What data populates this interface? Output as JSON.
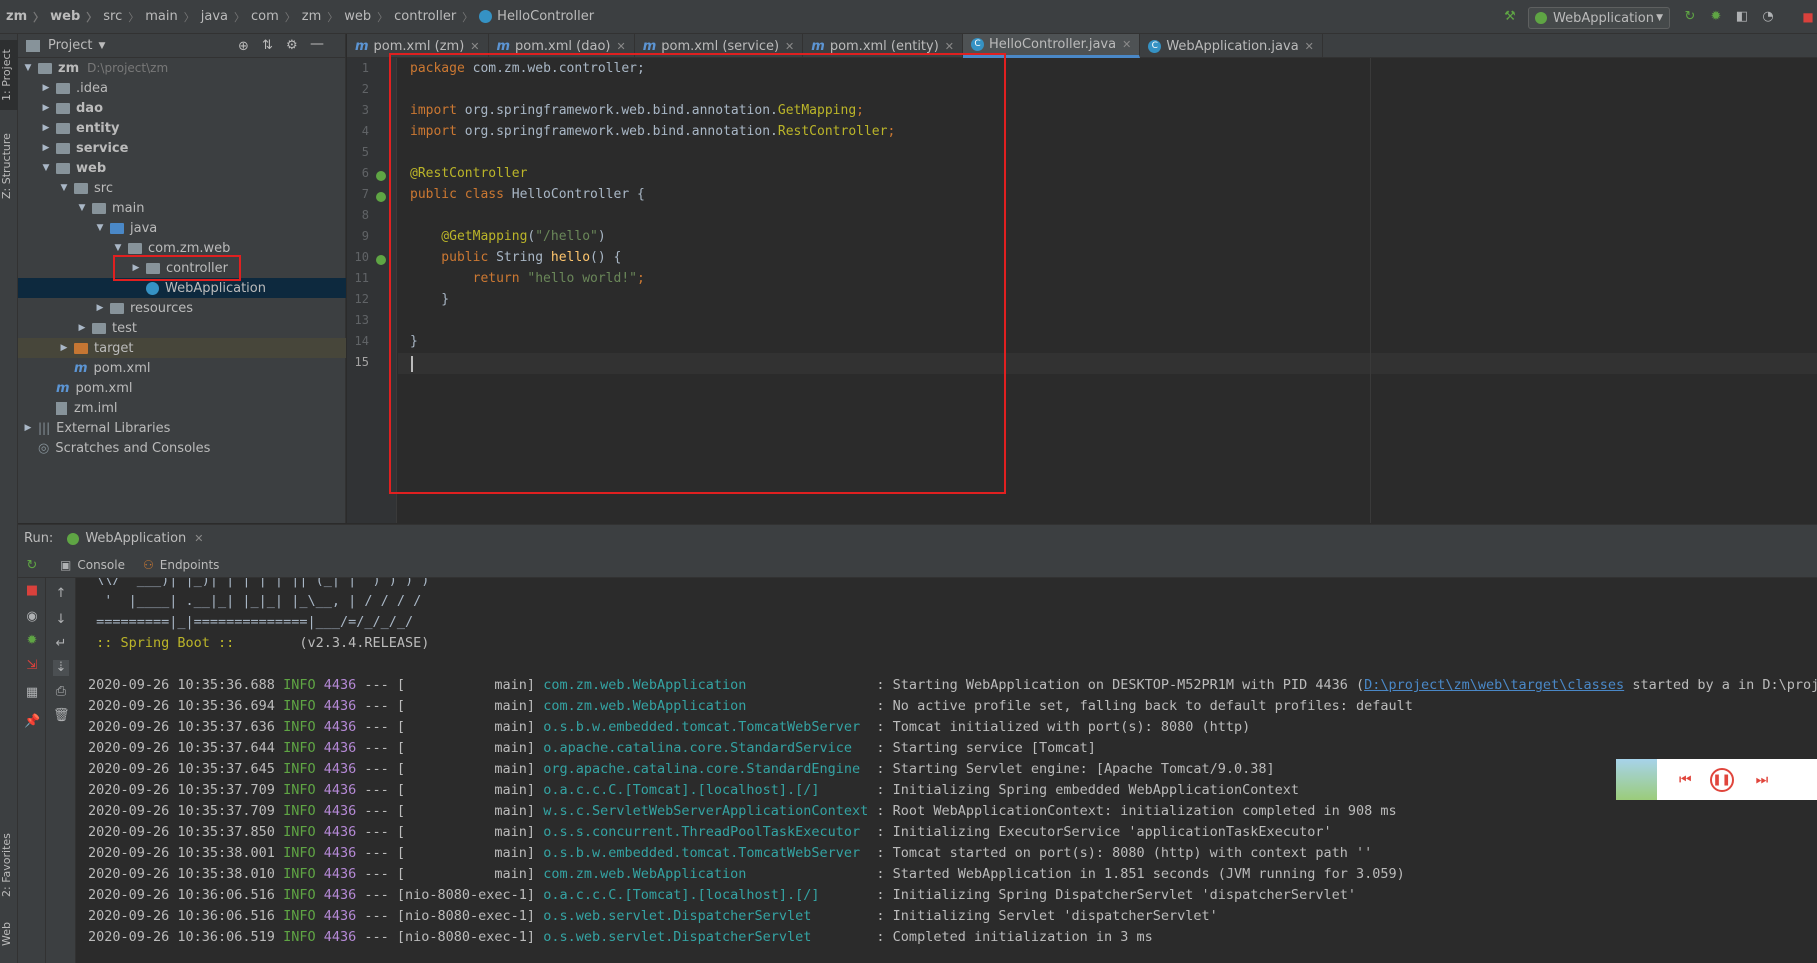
{
  "breadcrumb": [
    "zm",
    "web",
    "src",
    "main",
    "java",
    "com",
    "zm",
    "web",
    "controller",
    "HelloController"
  ],
  "run_config": "WebApplication",
  "left_stripe": {
    "project": "1: Project",
    "structure": "Z: Structure",
    "favorites": "2: Favorites",
    "web": "Web"
  },
  "project_panel": {
    "title": "Project",
    "tree": [
      {
        "label": "zm",
        "path": "D:\\project\\zm"
      },
      {
        "label": ".idea"
      },
      {
        "label": "dao"
      },
      {
        "label": "entity"
      },
      {
        "label": "service"
      },
      {
        "label": "web"
      },
      {
        "label": "src"
      },
      {
        "label": "main"
      },
      {
        "label": "java"
      },
      {
        "label": "com.zm.web"
      },
      {
        "label": "controller"
      },
      {
        "label": "WebApplication"
      },
      {
        "label": "resources"
      },
      {
        "label": "test"
      },
      {
        "label": "target"
      },
      {
        "label": "pom.xml"
      },
      {
        "label": "pom.xml"
      },
      {
        "label": "zm.iml"
      },
      {
        "label": "External Libraries"
      },
      {
        "label": "Scratches and Consoles"
      }
    ]
  },
  "editor_tabs": [
    {
      "label": "pom.xml (zm)"
    },
    {
      "label": "pom.xml (dao)"
    },
    {
      "label": "pom.xml (service)"
    },
    {
      "label": "pom.xml (entity)"
    },
    {
      "label": "HelloController.java",
      "active": true
    },
    {
      "label": "WebApplication.java"
    }
  ],
  "line_numbers": [
    "1",
    "2",
    "3",
    "4",
    "5",
    "6",
    "7",
    "8",
    "9",
    "10",
    "11",
    "12",
    "13",
    "14",
    "15"
  ],
  "code": {
    "l1_kw": "package",
    "l1_rest": " com.zm.web.controller;",
    "l3_kw": "import",
    "l3_rest": " org.springframework.web.bind.annotation.",
    "l3_ann": "GetMapping",
    "l3_end": ";",
    "l4_kw": "import",
    "l4_rest": " org.springframework.web.bind.annotation.",
    "l4_ann": "RestController",
    "l4_end": ";",
    "l6_ann": "@RestController",
    "l7_kw": "public class",
    "l7_rest": " HelloController {",
    "l9_ann": "    @GetMapping",
    "l9_p1": "(",
    "l9_str": "\"/hello\"",
    "l9_p2": ")",
    "l10_kw": "    public",
    "l10_type": " String ",
    "l10_fn": "hello",
    "l10_rest": "() {",
    "l11_kw": "        return",
    "l11_sp": " ",
    "l11_str": "\"hello world!\"",
    "l11_end": ";",
    "l12": "    }",
    "l14": "}"
  },
  "run": {
    "label": "Run:",
    "config": "WebApplication",
    "tabs": {
      "console": "Console",
      "endpoints": "Endpoints"
    }
  },
  "console": {
    "banner": [
      " \\\\/  ___)| |_)| | | | | || (_| |  ) ) ) )",
      "  '  |____| .__|_| |_|_| |_\\__, | / / / /",
      " =========|_|==============|___/=/_/_/_/"
    ],
    "spring_label": " :: Spring Boot ::",
    "spring_version": "        (v2.3.4.RELEASE)",
    "logs": [
      {
        "ts": "2020-09-26 10:35:36.688",
        "lvl": "INFO",
        "pid": "4436",
        "mid": " --- [           main] ",
        "logger": "com.zm.web.WebApplication               ",
        "msg": " : Starting WebApplication on DESKTOP-M52PR1M with PID 4436 (",
        "link": "D:\\project\\zm\\web\\target\\classes",
        "after": " started by a in D:\\project"
      },
      {
        "ts": "2020-09-26 10:35:36.694",
        "lvl": "INFO",
        "pid": "4436",
        "mid": " --- [           main] ",
        "logger": "com.zm.web.WebApplication               ",
        "msg": " : No active profile set, falling back to default profiles: default"
      },
      {
        "ts": "2020-09-26 10:35:37.636",
        "lvl": "INFO",
        "pid": "4436",
        "mid": " --- [           main] ",
        "logger": "o.s.b.w.embedded.tomcat.TomcatWebServer ",
        "msg": " : Tomcat initialized with port(s): 8080 (http)"
      },
      {
        "ts": "2020-09-26 10:35:37.644",
        "lvl": "INFO",
        "pid": "4436",
        "mid": " --- [           main] ",
        "logger": "o.apache.catalina.core.StandardService  ",
        "msg": " : Starting service [Tomcat]"
      },
      {
        "ts": "2020-09-26 10:35:37.645",
        "lvl": "INFO",
        "pid": "4436",
        "mid": " --- [           main] ",
        "logger": "org.apache.catalina.core.StandardEngine ",
        "msg": " : Starting Servlet engine: [Apache Tomcat/9.0.38]"
      },
      {
        "ts": "2020-09-26 10:35:37.709",
        "lvl": "INFO",
        "pid": "4436",
        "mid": " --- [           main] ",
        "logger": "o.a.c.c.C.[Tomcat].[localhost].[/]      ",
        "msg": " : Initializing Spring embedded WebApplicationContext"
      },
      {
        "ts": "2020-09-26 10:35:37.709",
        "lvl": "INFO",
        "pid": "4436",
        "mid": " --- [           main] ",
        "logger": "w.s.c.ServletWebServerApplicationContext",
        "msg": " : Root WebApplicationContext: initialization completed in 908 ms"
      },
      {
        "ts": "2020-09-26 10:35:37.850",
        "lvl": "INFO",
        "pid": "4436",
        "mid": " --- [           main] ",
        "logger": "o.s.s.concurrent.ThreadPoolTaskExecutor ",
        "msg": " : Initializing ExecutorService 'applicationTaskExecutor'"
      },
      {
        "ts": "2020-09-26 10:35:38.001",
        "lvl": "INFO",
        "pid": "4436",
        "mid": " --- [           main] ",
        "logger": "o.s.b.w.embedded.tomcat.TomcatWebServer ",
        "msg": " : Tomcat started on port(s): 8080 (http) with context path ''"
      },
      {
        "ts": "2020-09-26 10:35:38.010",
        "lvl": "INFO",
        "pid": "4436",
        "mid": " --- [           main] ",
        "logger": "com.zm.web.WebApplication               ",
        "msg": " : Started WebApplication in 1.851 seconds (JVM running for 3.059)"
      },
      {
        "ts": "2020-09-26 10:36:06.516",
        "lvl": "INFO",
        "pid": "4436",
        "mid": " --- [nio-8080-exec-1] ",
        "logger": "o.a.c.c.C.[Tomcat].[localhost].[/]      ",
        "msg": " : Initializing Spring DispatcherServlet 'dispatcherServlet'"
      },
      {
        "ts": "2020-09-26 10:36:06.516",
        "lvl": "INFO",
        "pid": "4436",
        "mid": " --- [nio-8080-exec-1] ",
        "logger": "o.s.web.servlet.DispatcherServlet       ",
        "msg": " : Initializing Servlet 'dispatcherServlet'"
      },
      {
        "ts": "2020-09-26 10:36:06.519",
        "lvl": "INFO",
        "pid": "4436",
        "mid": " --- [nio-8080-exec-1] ",
        "logger": "o.s.web.servlet.DispatcherServlet       ",
        "msg": " : Completed initialization in 3 ms"
      }
    ]
  },
  "icons": {
    "hammer": "hammer-icon",
    "rerun": "rerun-icon",
    "debug": "debug-icon",
    "stop": "stop-icon",
    "target": "locate-icon",
    "collapse": "collapse-icon",
    "gear": "gear-icon",
    "minimize": "minimize-icon"
  },
  "colors": {
    "highlight_box": "#e02020",
    "keyword": "#cc7832",
    "annotation": "#bbb529",
    "string": "#6a8759",
    "info": "#5fa544"
  }
}
